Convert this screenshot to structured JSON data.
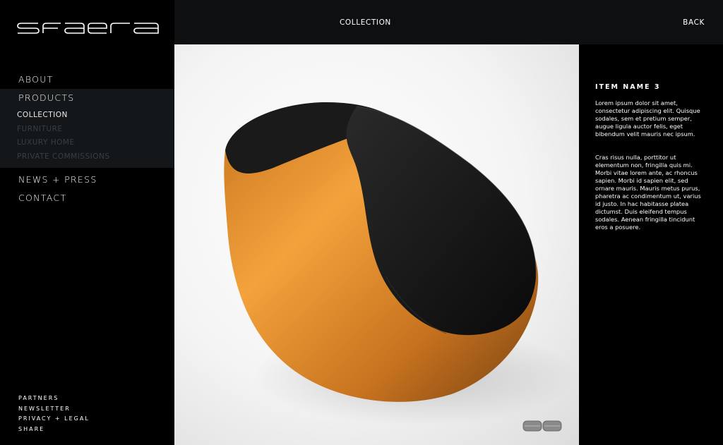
{
  "brand": {
    "logo_text": "sfaera"
  },
  "nav": {
    "about": "ABOUT",
    "products": "PRODUCTS",
    "sub_items": [
      {
        "label": "COLLECTION",
        "active": true
      },
      {
        "label": "FURNITURE",
        "active": false
      },
      {
        "label": "LUXURY HOME",
        "active": false
      },
      {
        "label": "PRIVATE COMMISSIONS",
        "active": false
      }
    ],
    "news": "NEWS + PRESS",
    "contact": "CONTACT"
  },
  "footer": {
    "partners": "PARTNERS",
    "newsletter": "NEWSLETTER",
    "privacy": "PRIVACY + LEGAL",
    "share": "SHARE"
  },
  "topbar": {
    "section": "COLLECTION",
    "back": "BACK"
  },
  "product": {
    "name": "ITEM NAME 3",
    "description_1": "Lorem ipsum dolor sit amet, consectetur adipiscing elit. Quisque sodales, sem et pretium semper, augue ligula auctor felis, eget bibendum velit mauris nec ipsum.",
    "description_2": "Cras risus nulla, porttitor ut elementum non, fringilla quis mi. Morbi vitae lorem ante, ac rhoncus sapien. Morbi id sapien elit, sed ornare mauris. Mauris metus purus, pharetra ac condimentum ut, varius id justo. In hac habitasse platea dictumst. Duis eleifend tempus sodales. Aenean fringilla tincidunt eros a posuere."
  },
  "colors": {
    "accent_orange": "#e8902a",
    "background": "#000000",
    "topbar": "#0d0f11",
    "submenu_bg": "#141719",
    "inactive_sub": "#3a3e42"
  }
}
